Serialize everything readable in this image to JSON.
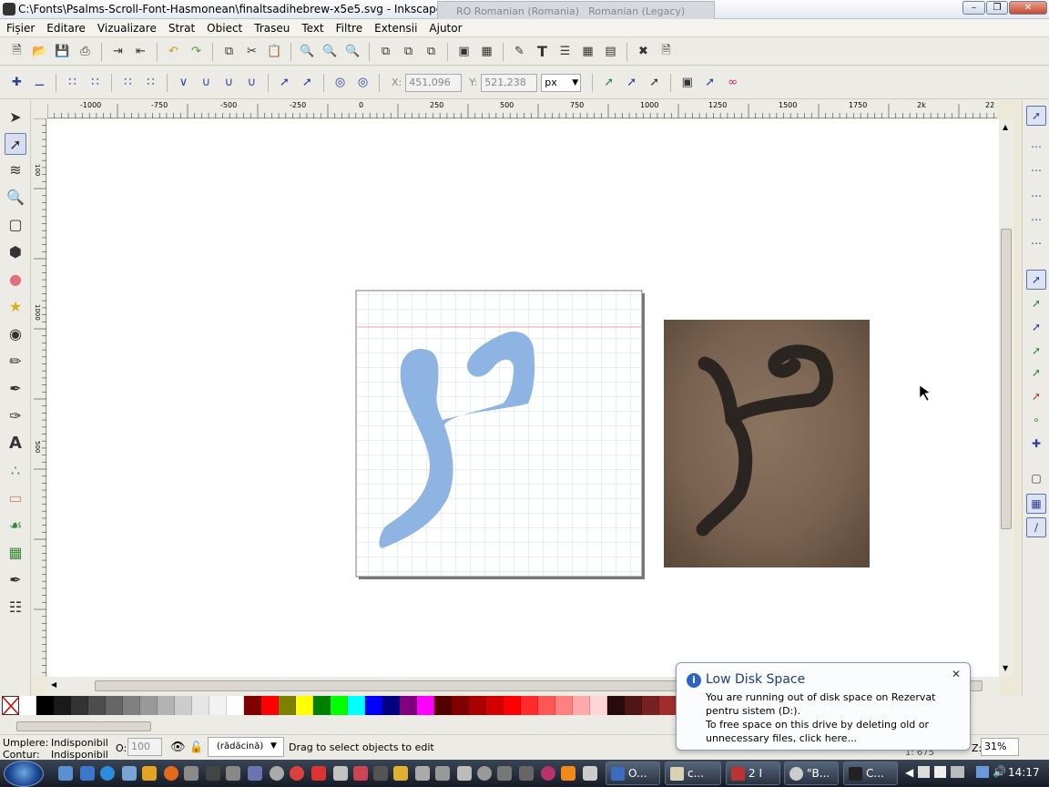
{
  "window": {
    "title": "C:\\Fonts\\Psalms-Scroll-Font-Hasmonean\\finaltsadihebrew-x5e5.svg - Inkscape"
  },
  "langbar": {
    "lang1": "RO Romanian (Romania)",
    "lang2": "Romanian (Legacy)"
  },
  "menu": [
    "Fișier",
    "Editare",
    "Vizualizare",
    "Strat",
    "Obiect",
    "Traseu",
    "Text",
    "Filtre",
    "Extensii",
    "Ajutor"
  ],
  "toolbar2": {
    "x_label": "X:",
    "x_value": "451,096",
    "y_label": "Y:",
    "y_value": "521,238",
    "unit": "px"
  },
  "ruler": {
    "h_ticks": [
      "-1000",
      "-750",
      "-500",
      "-250",
      "0",
      "250",
      "500",
      "750",
      "1000",
      "1250",
      "1500",
      "1750",
      "2k",
      "22"
    ],
    "v_ticks": [
      "100",
      "1000",
      "500"
    ]
  },
  "palette": [
    "#ffffff",
    "#000000",
    "#1a1a1a",
    "#333333",
    "#4d4d4d",
    "#666666",
    "#808080",
    "#999999",
    "#b3b3b3",
    "#cccccc",
    "#e6e6e6",
    "#f2f2f2",
    "#ffffff",
    "#800000",
    "#ff0000",
    "#808000",
    "#ffff00",
    "#008000",
    "#00ff00",
    "#00ffff",
    "#0000ff",
    "#000080",
    "#800080",
    "#ff00ff",
    "#550000",
    "#800000",
    "#aa0000",
    "#d40000",
    "#ff0000",
    "#ff2a2a",
    "#ff5555",
    "#ff8080",
    "#ffaaaa",
    "#ffd5d5",
    "#280b0b",
    "#501616",
    "#782121",
    "#a02c2c",
    "#c83737",
    "#d35f5f",
    "#de8787",
    "#e9afaf",
    "#f4d7d7",
    "#552200",
    "#803300",
    "#aa4400",
    "#d45500",
    "#ff6600"
  ],
  "status": {
    "fill_label": "Umplere:",
    "fill_value": "Indisponibil",
    "stroke_label": "Contur:",
    "stroke_value": "Indisponibil",
    "opacity_label": "O:",
    "opacity_value": "100",
    "layer": "(rădăcină)",
    "message": "Drag to select objects to edit",
    "zoom_label": "Z:",
    "zoom_value": "31%",
    "coords": "1: 675"
  },
  "notification": {
    "title": "Low Disk Space",
    "line1": "You are running out of disk space on Rezervat pentru sistem (D:).",
    "line2": "To free space on this drive by deleting old or unnecessary files, click here..."
  },
  "taskbar": {
    "buttons": [
      "O...",
      "c...",
      "2 I",
      "\"B...",
      "C..."
    ],
    "clock": "14:17"
  }
}
